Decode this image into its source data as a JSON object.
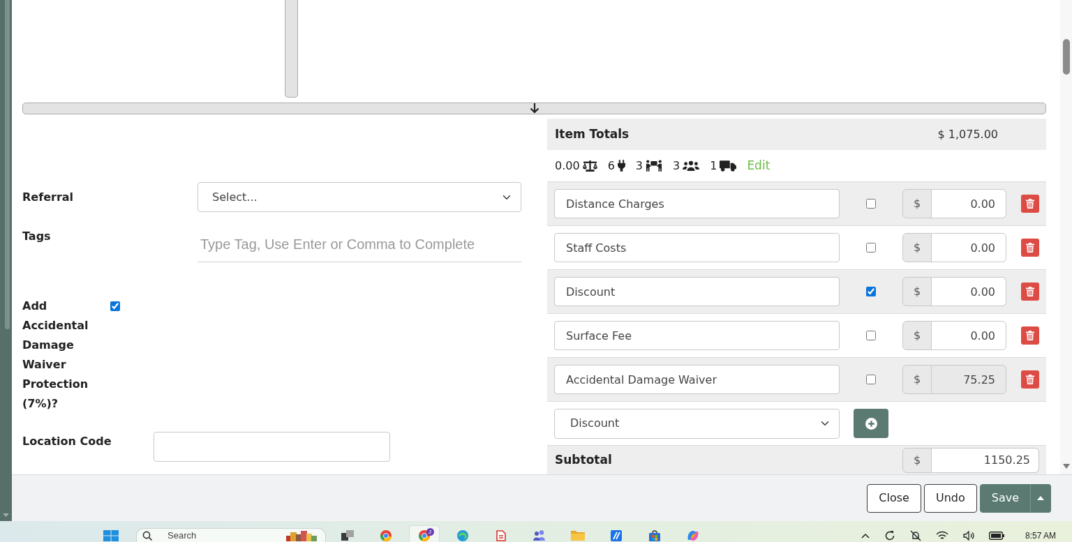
{
  "form": {
    "referral": {
      "label": "Referral",
      "value": "Select..."
    },
    "tags": {
      "label": "Tags",
      "placeholder": "Type Tag, Use Enter or Comma to Complete"
    },
    "damage_waiver": {
      "label": "Add Accidental Damage Waiver Protection (7%)?",
      "checked": true
    },
    "location_code": {
      "label": "Location Code"
    }
  },
  "totals": {
    "title": "Item Totals",
    "amount": "$ 1,075.00",
    "stats": [
      {
        "kind": "weight",
        "value": "0.00"
      },
      {
        "kind": "power",
        "value": "6"
      },
      {
        "kind": "movers",
        "value": "3"
      },
      {
        "kind": "staff",
        "value": "3"
      },
      {
        "kind": "trucks",
        "value": "1"
      }
    ],
    "edit_link": "Edit"
  },
  "charges": [
    {
      "name": "Distance Charges",
      "checked": false,
      "currency": "$",
      "amount": "0.00",
      "disabled": false
    },
    {
      "name": "Staff Costs",
      "checked": false,
      "currency": "$",
      "amount": "0.00",
      "disabled": false
    },
    {
      "name": "Discount",
      "checked": true,
      "currency": "$",
      "amount": "0.00",
      "disabled": false
    },
    {
      "name": "Surface Fee",
      "checked": false,
      "currency": "$",
      "amount": "0.00",
      "disabled": false
    },
    {
      "name": "Accidental Damage Waiver",
      "checked": false,
      "currency": "$",
      "amount": "75.25",
      "disabled": true
    }
  ],
  "add_charge": {
    "value": "Discount"
  },
  "subtotal": {
    "label": "Subtotal",
    "currency": "$",
    "amount": "1150.25"
  },
  "footer": {
    "buttons": [
      {
        "label": "Close",
        "kind": "outline",
        "menu": false
      },
      {
        "label": "Undo",
        "kind": "outline",
        "menu": false
      },
      {
        "label": "Save",
        "kind": "primary",
        "menu": true
      }
    ]
  },
  "taskbar": {
    "search": {
      "placeholder": "Search"
    },
    "apps": [
      {
        "kind": "window",
        "selected": false
      },
      {
        "kind": "ring",
        "selected": false
      },
      {
        "kind": "badged",
        "selected": true,
        "badge": "J"
      },
      {
        "kind": "swirl",
        "selected": false
      },
      {
        "kind": "document",
        "selected": false
      },
      {
        "kind": "people",
        "selected": false
      },
      {
        "kind": "folder",
        "selected": false
      },
      {
        "kind": "tile",
        "selected": false
      },
      {
        "kind": "bag",
        "selected": false
      },
      {
        "kind": "sparkle",
        "selected": false
      }
    ],
    "clock": "8:57 AM"
  }
}
